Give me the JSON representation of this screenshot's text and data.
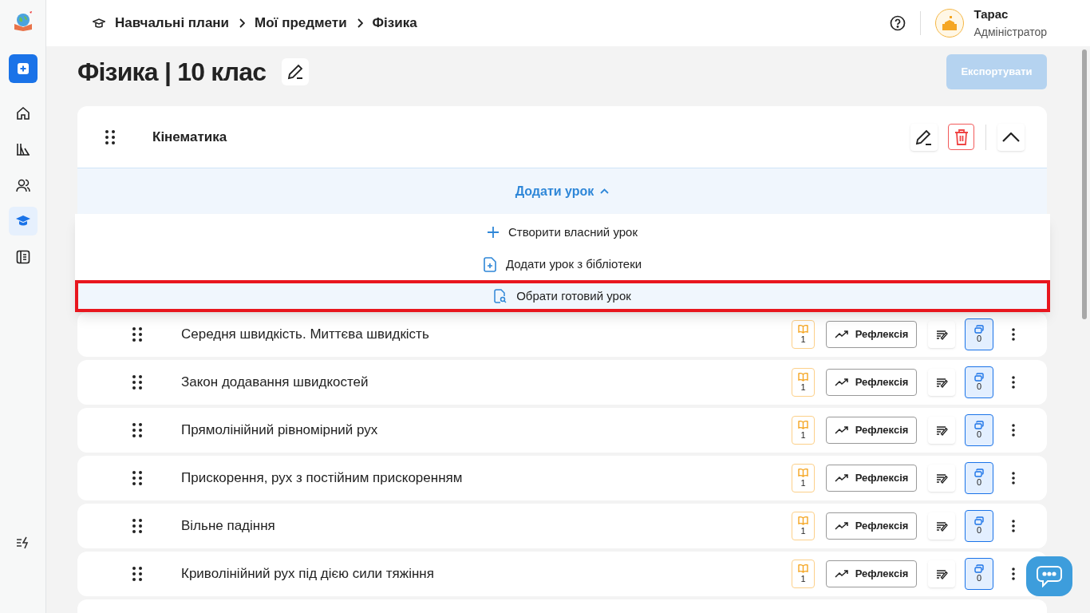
{
  "sidebar": {
    "items": [
      {
        "kind": "home",
        "selected": false
      },
      {
        "kind": "library",
        "selected": false
      },
      {
        "kind": "users",
        "selected": false
      },
      {
        "kind": "courses",
        "selected": true
      },
      {
        "kind": "journal",
        "selected": false
      }
    ]
  },
  "breadcrumbs": [
    "Навчальні плани",
    "Мої предмети",
    "Фізика"
  ],
  "user": {
    "name": "Тарас",
    "role": "Адміністратор"
  },
  "page": {
    "title": "Фізика | 10 клас",
    "export_button": {
      "label": "Експортувати",
      "disabled": true
    }
  },
  "section": {
    "title": "Кінематика",
    "expanded": true,
    "add_lesson": {
      "label": "Додати урок",
      "expanded": true
    }
  },
  "add_menu": [
    {
      "kind": "create",
      "label": "Створити власний урок",
      "selected": false
    },
    {
      "kind": "library",
      "label": "Додати урок з бібліотеки",
      "selected": false
    },
    {
      "kind": "ready",
      "label": "Обрати готовий урок",
      "selected": true
    }
  ],
  "lessons": [
    {
      "title": "Середня швидкість. Миттєва швидкість",
      "materials": "1",
      "reflection": "Рефлексія",
      "copies": "0"
    },
    {
      "title": "Закон додавання швидкостей",
      "materials": "1",
      "reflection": "Рефлексія",
      "copies": "0"
    },
    {
      "title": "Прямолінійний рівномірний рух",
      "materials": "1",
      "reflection": "Рефлексія",
      "copies": "0"
    },
    {
      "title": "Прискорення, рух з постійним прискоренням",
      "materials": "1",
      "reflection": "Рефлексія",
      "copies": "0"
    },
    {
      "title": "Вільне падіння",
      "materials": "1",
      "reflection": "Рефлексія",
      "copies": "0"
    },
    {
      "title": "Криволінійний рух під дією сили тяжіння",
      "materials": "1",
      "reflection": "Рефлексія",
      "copies": "0"
    }
  ]
}
